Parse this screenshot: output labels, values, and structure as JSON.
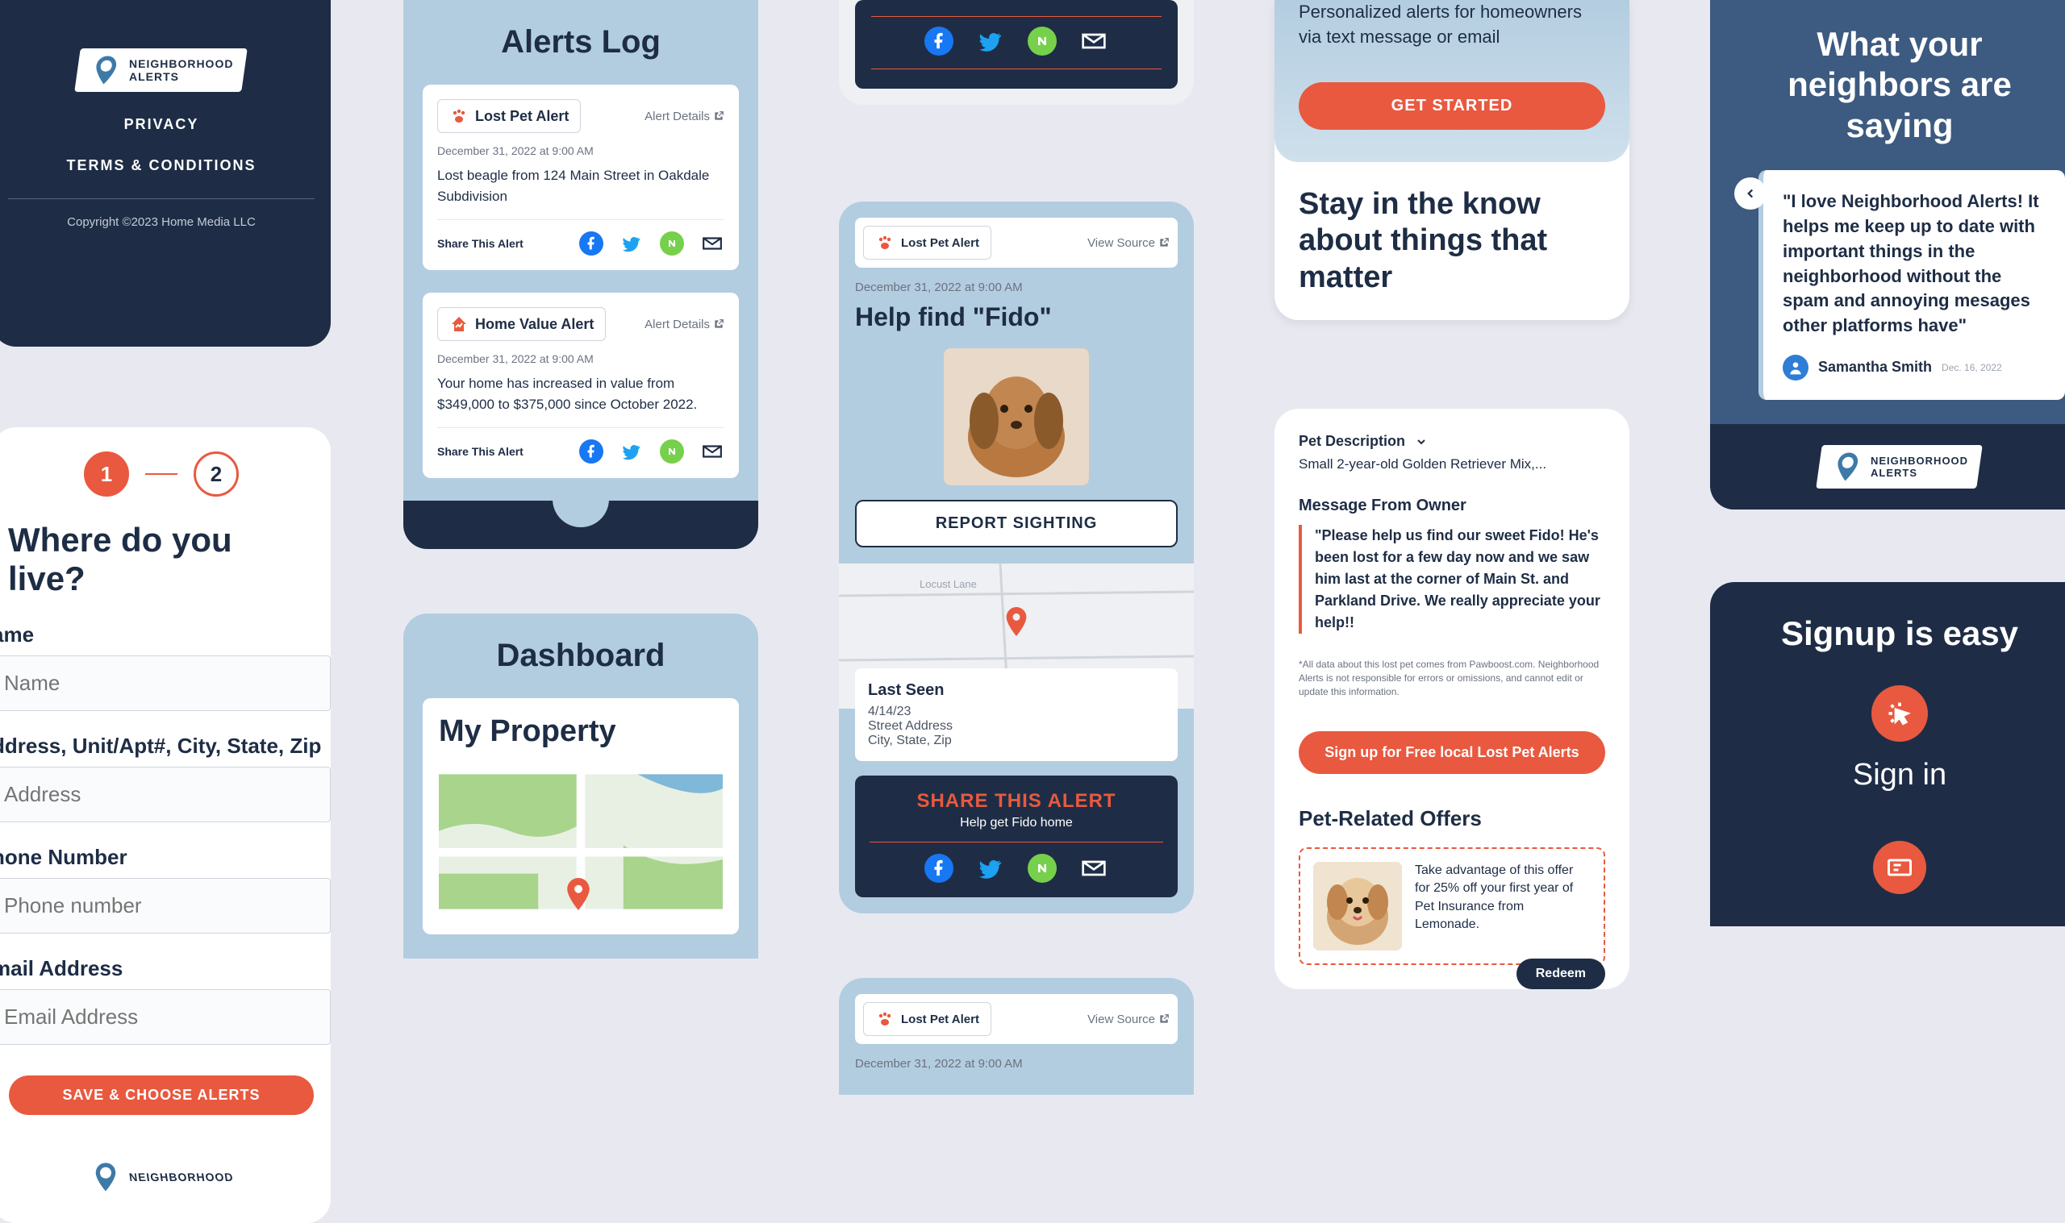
{
  "brand": {
    "line1": "NEIGHBORHOOD",
    "line2": "ALERTS"
  },
  "footer": {
    "privacy": "PRIVACY",
    "terms": "TERMS & CONDITIONS",
    "copyright": "Copyright ©2023 Home Media LLC"
  },
  "form": {
    "step1": "1",
    "step2": "2",
    "title": "Where do you live?",
    "name_label": "ame",
    "name_placeholder": "Name",
    "addr_label": "ddress, Unit/Apt#, City, State, Zip",
    "addr_placeholder": "Address",
    "phone_label": "hone Number",
    "phone_placeholder": "Phone number",
    "email_label": "mail Address",
    "email_placeholder": "Email Address",
    "submit": "SAVE & CHOOSE ALERTS"
  },
  "alerts": {
    "title": "Alerts Log",
    "items": [
      {
        "type": "Lost Pet Alert",
        "details_label": "Alert Details",
        "date": "December 31, 2022 at 9:00 AM",
        "body": "Lost beagle from 124 Main Street in Oakdale Subdivision",
        "share_label": "Share This Alert"
      },
      {
        "type": "Home Value Alert",
        "details_label": "Alert Details",
        "date": "December 31, 2022 at 9:00 AM",
        "body": "Your home has increased in value from $349,000 to $375,000 since October 2022.",
        "share_label": "Share This Alert"
      }
    ]
  },
  "dashboard": {
    "title": "Dashboard",
    "property": "My Property"
  },
  "pet": {
    "badge": "Lost Pet Alert",
    "view_source": "View Source",
    "date": "December 31, 2022 at 9:00 AM",
    "title": "Help find \"Fido\"",
    "report": "REPORT SIGHTING",
    "last_seen_title": "Last Seen",
    "last_seen_date": "4/14/23",
    "last_seen_addr": "Street Address",
    "last_seen_city": "City, State, Zip",
    "share_title": "SHARE THIS ALERT",
    "share_sub": "Help get Fido home"
  },
  "pet2": {
    "badge": "Lost Pet Alert",
    "view_source": "View Source",
    "date": "December 31, 2022 at 9:00 AM"
  },
  "hero": {
    "text": "Personalized alerts for homeowners via text message or email",
    "cta": "GET STARTED",
    "stay": "Stay in the know about things that matter"
  },
  "petinfo": {
    "desc_label": "Pet Description",
    "desc": "Small 2-year-old Golden Retriever Mix,...",
    "msg_title": "Message From Owner",
    "quote": "\"Please help us find our sweet Fido! He's been lost for a few day now and we saw him last at the corner of Main St. and Parkland Drive. We really appreciate your help!!",
    "disclaimer": "*All data about this lost pet comes from Pawboost.com. Neighborhood Alerts is not responsible for errors or omissions, and cannot edit or update this information.",
    "signup": "Sign up for Free local Lost Pet Alerts",
    "offers_title": "Pet-Related Offers",
    "offer_text": "Take advantage of this offer for 25% off your first year of Pet Insurance from Lemonade.",
    "redeem": "Redeem"
  },
  "testimonial": {
    "title": "What your neighbors are saying",
    "review": "\"I love Neighborhood Alerts! It helps me keep up to date with important things in the neighborhood without the spam and annoying mesages other platforms have\"",
    "author": "Samantha Smith",
    "date": "Dec. 16, 2022"
  },
  "signup": {
    "title": "Signup is easy",
    "signin": "Sign in"
  }
}
